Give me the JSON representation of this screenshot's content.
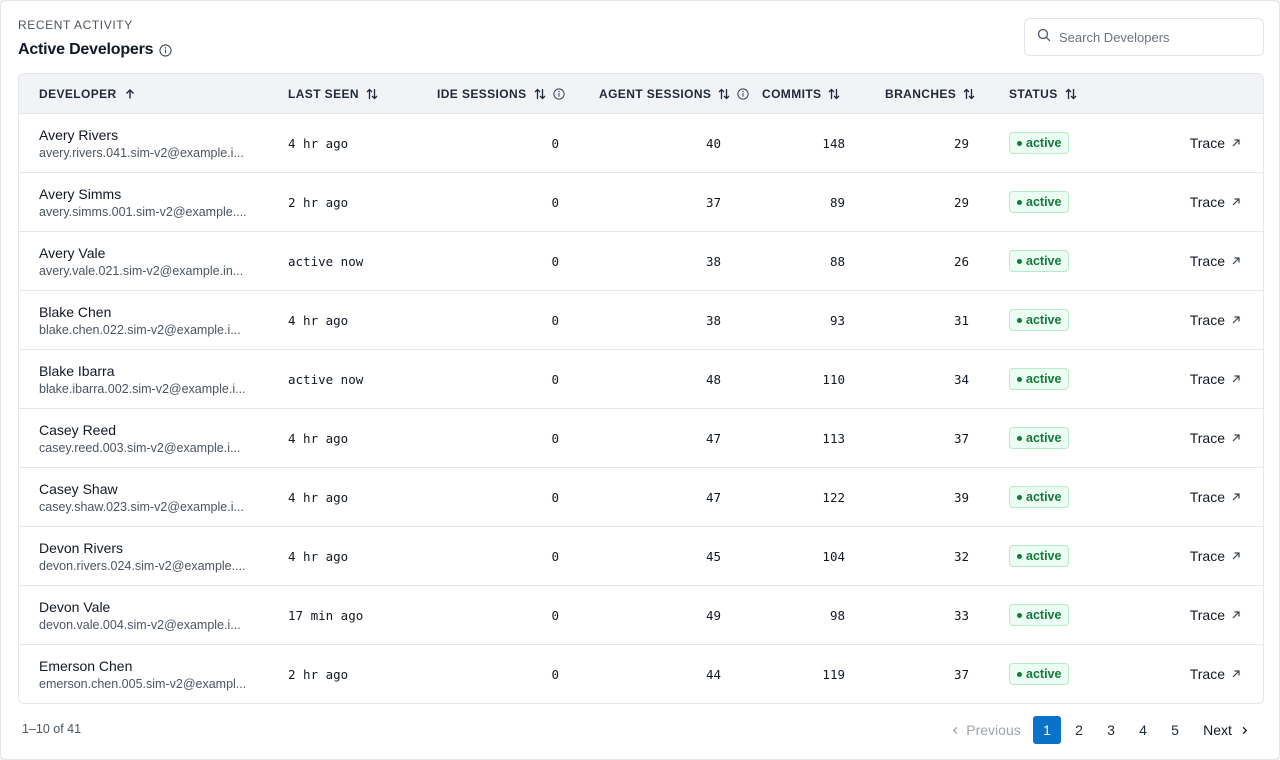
{
  "header": {
    "eyebrow": "RECENT ACTIVITY",
    "title": "Active Developers"
  },
  "search": {
    "placeholder": "Search Developers",
    "value": ""
  },
  "columns": {
    "developer": "DEVELOPER",
    "last_seen": "LAST SEEN",
    "ide_sessions": "IDE SESSIONS",
    "agent_sessions": "AGENT SESSIONS",
    "commits": "COMMITS",
    "branches": "BRANCHES",
    "status": "STATUS"
  },
  "rows": [
    {
      "name": "Avery Rivers",
      "email": "avery.rivers.041.sim-v2@example.i...",
      "last_seen": "4 hr ago",
      "ide": "0",
      "agent": "40",
      "commits": "148",
      "branches": "29",
      "status": "active",
      "action": "Trace"
    },
    {
      "name": "Avery Simms",
      "email": "avery.simms.001.sim-v2@example....",
      "last_seen": "2 hr ago",
      "ide": "0",
      "agent": "37",
      "commits": "89",
      "branches": "29",
      "status": "active",
      "action": "Trace"
    },
    {
      "name": "Avery Vale",
      "email": "avery.vale.021.sim-v2@example.in...",
      "last_seen": "active now",
      "ide": "0",
      "agent": "38",
      "commits": "88",
      "branches": "26",
      "status": "active",
      "action": "Trace"
    },
    {
      "name": "Blake Chen",
      "email": "blake.chen.022.sim-v2@example.i...",
      "last_seen": "4 hr ago",
      "ide": "0",
      "agent": "38",
      "commits": "93",
      "branches": "31",
      "status": "active",
      "action": "Trace"
    },
    {
      "name": "Blake Ibarra",
      "email": "blake.ibarra.002.sim-v2@example.i...",
      "last_seen": "active now",
      "ide": "0",
      "agent": "48",
      "commits": "110",
      "branches": "34",
      "status": "active",
      "action": "Trace"
    },
    {
      "name": "Casey Reed",
      "email": "casey.reed.003.sim-v2@example.i...",
      "last_seen": "4 hr ago",
      "ide": "0",
      "agent": "47",
      "commits": "113",
      "branches": "37",
      "status": "active",
      "action": "Trace"
    },
    {
      "name": "Casey Shaw",
      "email": "casey.shaw.023.sim-v2@example.i...",
      "last_seen": "4 hr ago",
      "ide": "0",
      "agent": "47",
      "commits": "122",
      "branches": "39",
      "status": "active",
      "action": "Trace"
    },
    {
      "name": "Devon Rivers",
      "email": "devon.rivers.024.sim-v2@example....",
      "last_seen": "4 hr ago",
      "ide": "0",
      "agent": "45",
      "commits": "104",
      "branches": "32",
      "status": "active",
      "action": "Trace"
    },
    {
      "name": "Devon Vale",
      "email": "devon.vale.004.sim-v2@example.i...",
      "last_seen": "17 min ago",
      "ide": "0",
      "agent": "49",
      "commits": "98",
      "branches": "33",
      "status": "active",
      "action": "Trace"
    },
    {
      "name": "Emerson Chen",
      "email": "emerson.chen.005.sim-v2@exampl...",
      "last_seen": "2 hr ago",
      "ide": "0",
      "agent": "44",
      "commits": "119",
      "branches": "37",
      "status": "active",
      "action": "Trace"
    }
  ],
  "pagination": {
    "summary": "1–10 of 41",
    "previous": "Previous",
    "pages": [
      "1",
      "2",
      "3",
      "4",
      "5"
    ],
    "current": "1",
    "next": "Next"
  },
  "colors": {
    "accent": "#0b72c9",
    "status_active_bg": "#ecfdf3",
    "status_active_text": "#137a3c",
    "header_bg": "#f1f3f6"
  },
  "icons": {
    "search": "search-icon",
    "info": "info-icon",
    "sort_asc": "arrow-up-icon",
    "sort": "sort-icon",
    "external": "arrow-up-right-icon",
    "chevron_left": "chevron-left-icon",
    "chevron_right": "chevron-right-icon"
  }
}
